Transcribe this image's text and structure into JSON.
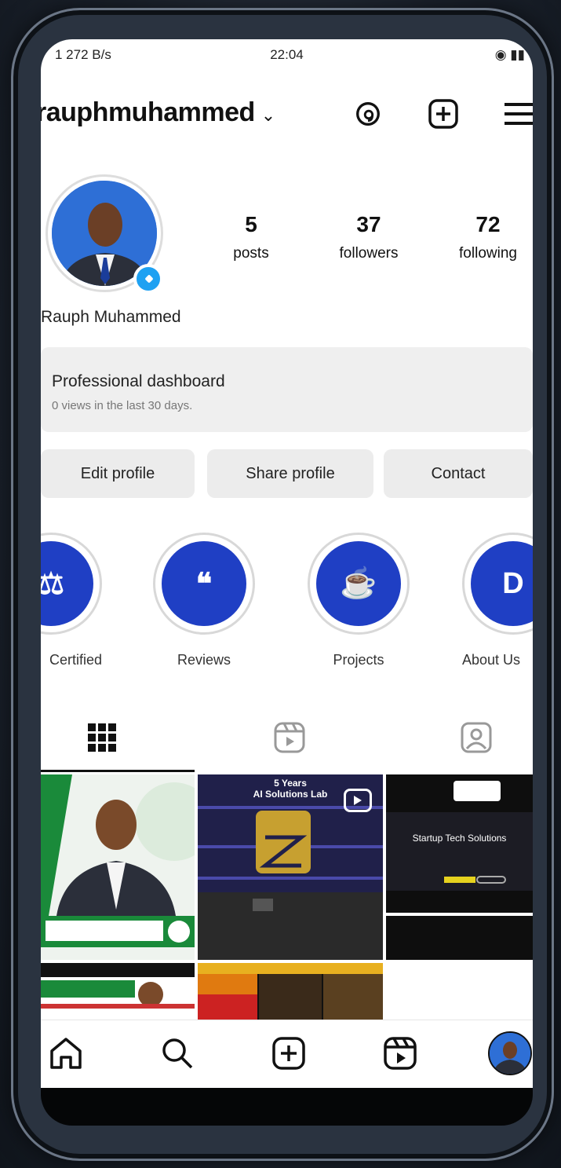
{
  "status_bar": {
    "left": "1 272 B/s",
    "time": "22:04",
    "right": "◉ ▮▮"
  },
  "header": {
    "username": "rauphmuhammed",
    "chevron": "⌄",
    "icons": [
      "threads-icon",
      "plus-square-icon",
      "menu-icon"
    ]
  },
  "profile": {
    "full_name": "Rauph Muhammed",
    "stats": [
      {
        "value": "5",
        "label": "posts"
      },
      {
        "value": "37",
        "label": "followers"
      },
      {
        "value": "72",
        "label": "following"
      }
    ]
  },
  "dashboard": {
    "title": "Professional dashboard",
    "subtitle": "0 views in the last 30 days."
  },
  "buttons": {
    "edit": "Edit profile",
    "share": "Share profile",
    "contact": "Contact"
  },
  "highlights": [
    {
      "label": "Certified",
      "glyph": "⚖"
    },
    {
      "label": "Reviews",
      "glyph": "❝"
    },
    {
      "label": "Projects",
      "glyph": "☕"
    },
    {
      "label": "About Us",
      "glyph": "D"
    }
  ],
  "tabs": [
    "grid-icon",
    "reels-icon",
    "tagged-icon"
  ],
  "posts": [
    {
      "caption": ""
    },
    {
      "caption": "5 Years\nAI Solutions Lab"
    },
    {
      "caption": "Startup Tech Solutions"
    }
  ],
  "nav": [
    "home-icon",
    "search-icon",
    "create-icon",
    "reels-icon",
    "profile-avatar"
  ],
  "colors": {
    "highlight_blue": "#1f3fc4",
    "verified_blue": "#1ea1f2",
    "bg": "#ffffff"
  }
}
